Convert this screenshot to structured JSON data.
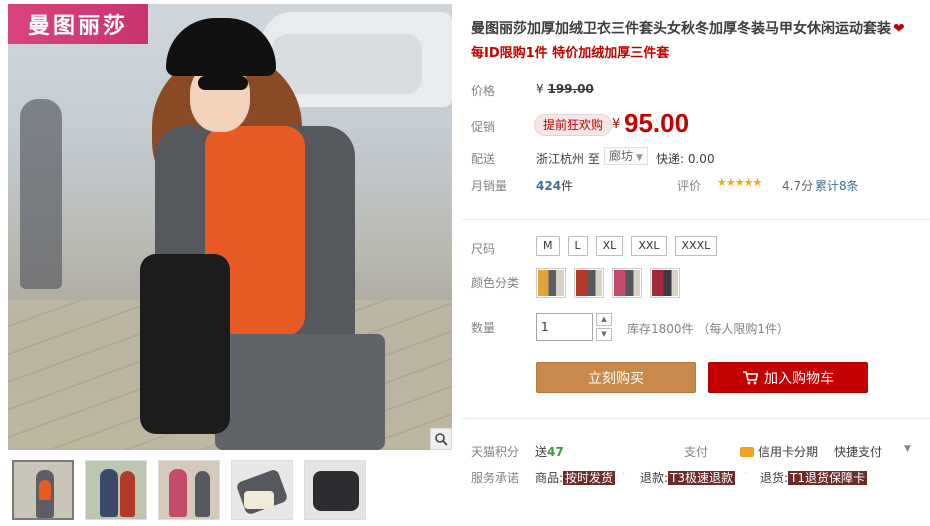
{
  "brand_badge": "曼图丽莎",
  "product": {
    "title": "曼图丽莎加厚加绒卫衣三件套头女秋冬加厚冬装马甲女休闲运动套装",
    "subtitle": "每ID限购1件 特价加绒加厚三件套"
  },
  "price": {
    "label": "价格",
    "original_prefix": "¥",
    "original": "199.00"
  },
  "promo": {
    "label": "促销",
    "tag": "提前狂欢购",
    "currency": "¥",
    "price": "95.00"
  },
  "shipping": {
    "label": "配送",
    "from": "浙江杭州 至",
    "to": "廊坊",
    "fee": "快递: 0.00"
  },
  "sales": {
    "label": "月销量",
    "count": "424",
    "unit": "件",
    "rating_label": "评价",
    "stars": "★★★★★",
    "score": "4.7分",
    "reviews": "累计8条"
  },
  "size": {
    "label": "尺码",
    "options": [
      "M",
      "L",
      "XL",
      "XXL",
      "XXXL"
    ]
  },
  "color": {
    "label": "颜色分类",
    "swatches": [
      "#8a6b2a",
      "#b33a2a",
      "#c44a6a",
      "#a22a3a"
    ]
  },
  "quantity": {
    "label": "数量",
    "value": "1",
    "up": "▲",
    "down": "▼",
    "stock": "库存1800件 （每人限购1件）"
  },
  "actions": {
    "buy_now": "立刻购买",
    "add_cart": "加入购物车"
  },
  "points": {
    "label": "天猫积分",
    "prefix": "送",
    "value": "47"
  },
  "payment": {
    "label": "支付",
    "credit": "信用卡分期",
    "quick": "快捷支付",
    "caret": "▼"
  },
  "service": {
    "label": "服务承诺",
    "goods_label": "商品:",
    "goods_tag": "按时发货",
    "refund_label": "退款:",
    "refund_tag": "T3极速退款",
    "return_label": "退货:",
    "return_tag": "T1退货保障卡"
  },
  "zoom_icon": "magnifier-icon"
}
